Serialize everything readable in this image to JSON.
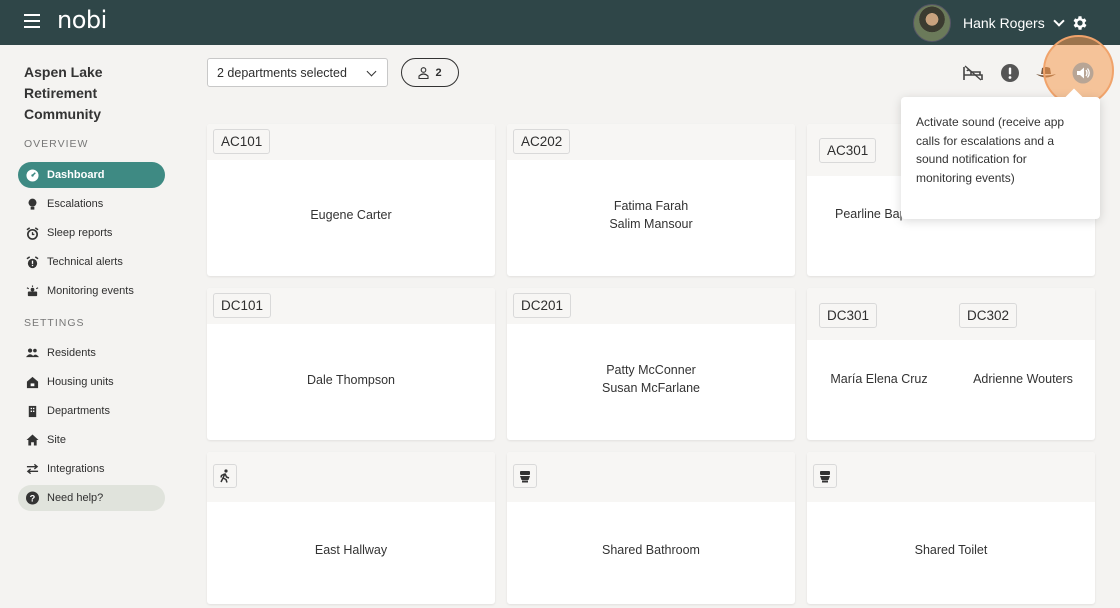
{
  "app": {
    "logo": "nobi"
  },
  "header": {
    "user_name": "Hank Rogers"
  },
  "sidebar": {
    "site_name": "Aspen Lake Retirement Community",
    "overview_label": "OVERVIEW",
    "settings_label": "SETTINGS",
    "overview_items": [
      {
        "label": "Dashboard",
        "icon": "dashboard-icon"
      },
      {
        "label": "Escalations",
        "icon": "bulb-icon"
      },
      {
        "label": "Sleep reports",
        "icon": "alarm-icon"
      },
      {
        "label": "Technical alerts",
        "icon": "alarm-alert-icon"
      },
      {
        "label": "Monitoring events",
        "icon": "monitor-icon"
      }
    ],
    "settings_items": [
      {
        "label": "Residents",
        "icon": "people-icon"
      },
      {
        "label": "Housing units",
        "icon": "house-lock-icon"
      },
      {
        "label": "Departments",
        "icon": "building-icon"
      },
      {
        "label": "Site",
        "icon": "home-icon"
      },
      {
        "label": "Integrations",
        "icon": "swap-icon"
      }
    ],
    "help": "Need help?"
  },
  "filters": {
    "departments": "2 departments selected",
    "people_count": "2"
  },
  "tooltip": {
    "text": "Activate sound (receive app calls for escalations and a sound notification for monitoring events)"
  },
  "cards": {
    "ac101": {
      "tag": "AC101",
      "names": [
        "Eugene Carter"
      ]
    },
    "ac202": {
      "tag": "AC202",
      "names": [
        "Fatima Farah",
        "Salim Mansour"
      ]
    },
    "ac301": {
      "tag": "AC301",
      "names": [
        "Pearline Bap"
      ]
    },
    "dc101": {
      "tag": "DC101",
      "names": [
        "Dale Thompson"
      ]
    },
    "dc201": {
      "tag": "DC201",
      "names": [
        "Patty McConner",
        "Susan McFarlane"
      ]
    },
    "dc301": {
      "tag": "DC301",
      "names": [
        "María Elena Cruz"
      ]
    },
    "dc302": {
      "tag": "DC302",
      "names": [
        "Adrienne Wouters"
      ]
    },
    "hallway": {
      "icon": "walking-icon",
      "names": [
        "East Hallway"
      ]
    },
    "bathroom": {
      "icon": "toilet-icon",
      "names": [
        "Shared Bathroom"
      ]
    },
    "toilet": {
      "icon": "toilet-icon",
      "names": [
        "Shared Toilet"
      ]
    }
  },
  "colors": {
    "topbar": "#2f4648",
    "accent": "#3e8a83",
    "highlight": "#f59b50"
  }
}
